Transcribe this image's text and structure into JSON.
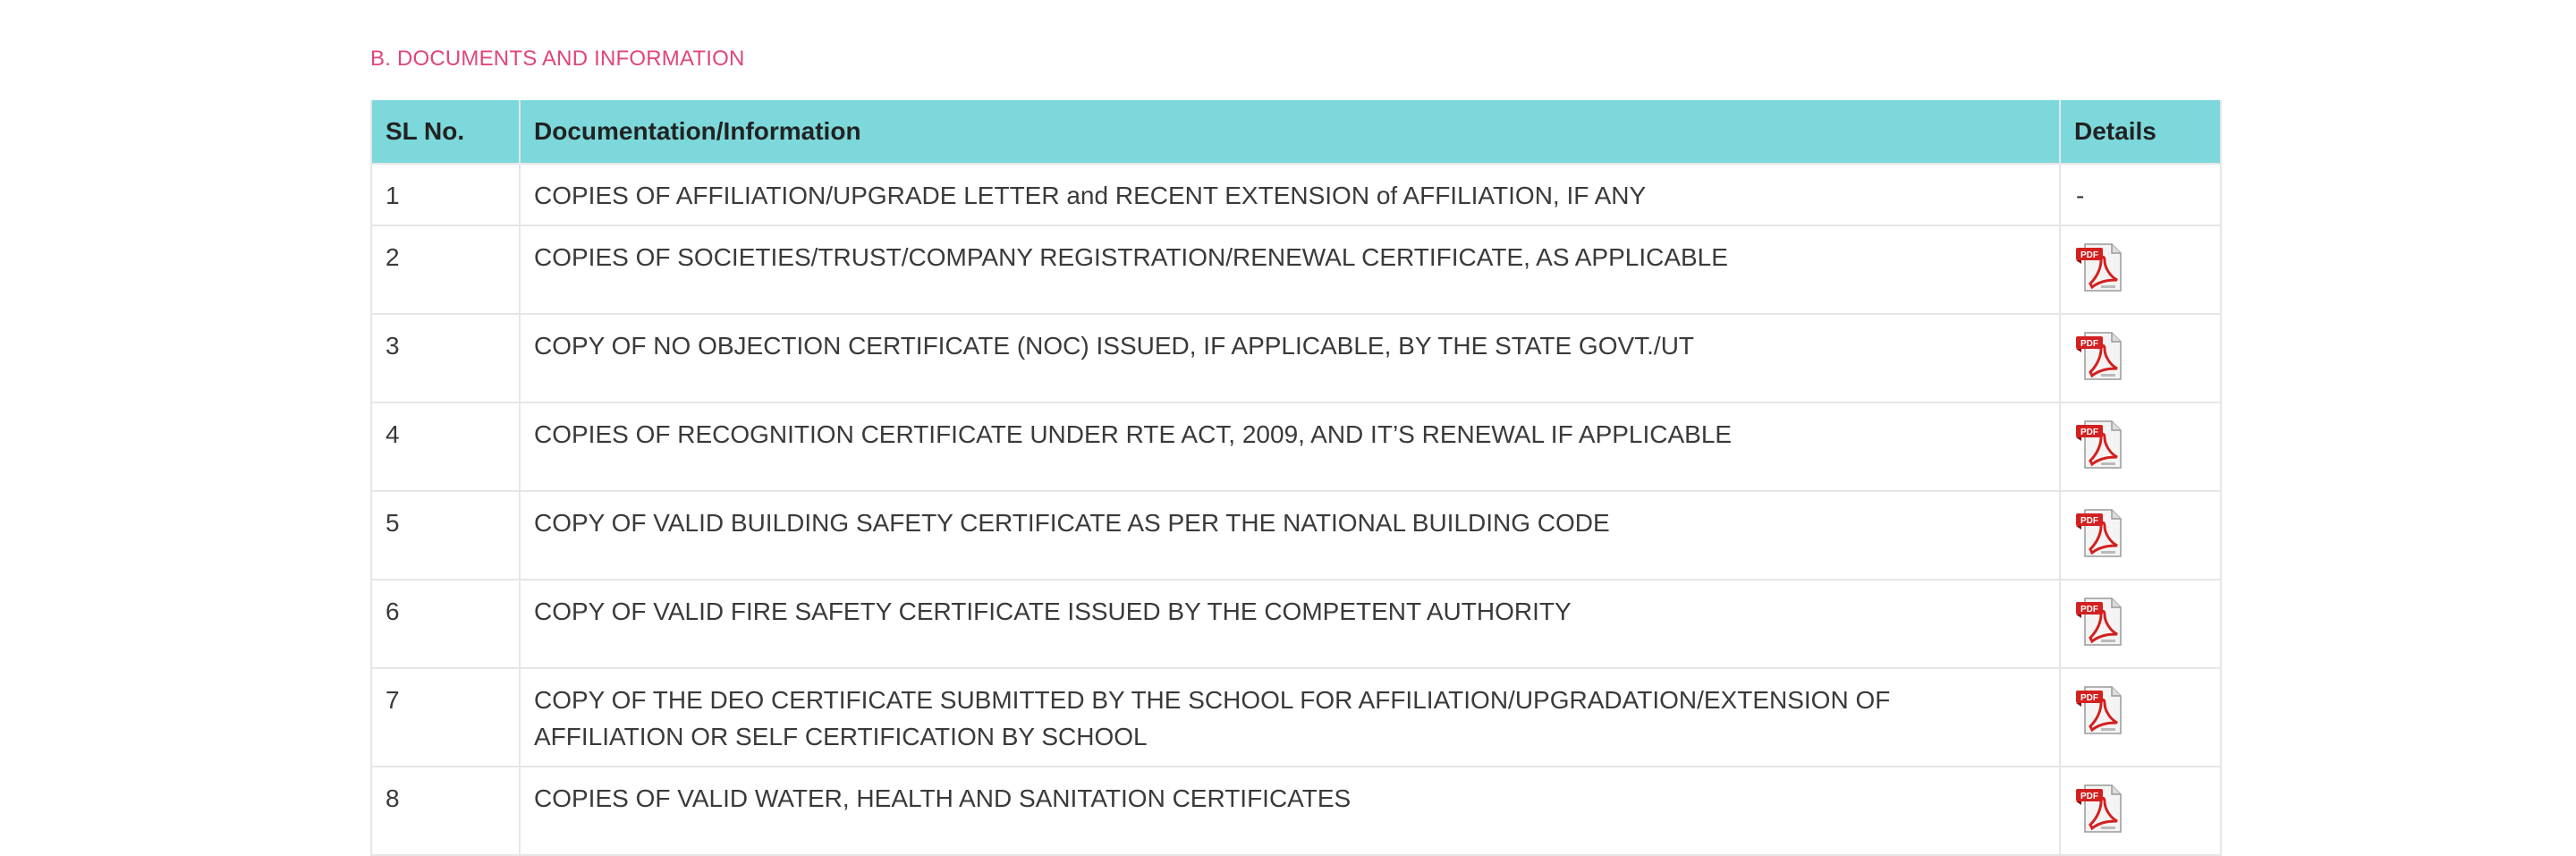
{
  "section": {
    "title": "B. DOCUMENTS AND INFORMATION"
  },
  "table": {
    "headers": {
      "sl": "SL No.",
      "doc": "Documentation/Information",
      "details": "Details"
    },
    "rows": [
      {
        "sl": "1",
        "doc": "COPIES OF AFFILIATION/UPGRADE LETTER and RECENT EXTENSION of AFFILIATION, IF ANY",
        "details": "-"
      },
      {
        "sl": "2",
        "doc": "COPIES OF SOCIETIES/TRUST/COMPANY REGISTRATION/RENEWAL CERTIFICATE, AS APPLICABLE",
        "details_icon": "pdf-icon"
      },
      {
        "sl": "3",
        "doc": "COPY OF NO OBJECTION CERTIFICATE (NOC) ISSUED, IF APPLICABLE, BY THE STATE GOVT./UT",
        "details_icon": "pdf-icon"
      },
      {
        "sl": "4",
        "doc": "COPIES OF RECOGNITION CERTIFICATE UNDER RTE ACT, 2009, AND IT’S RENEWAL IF APPLICABLE",
        "details_icon": "pdf-icon"
      },
      {
        "sl": "5",
        "doc": "COPY OF VALID BUILDING SAFETY CERTIFICATE AS PER THE NATIONAL BUILDING CODE",
        "details_icon": "pdf-icon"
      },
      {
        "sl": "6",
        "doc": "COPY OF VALID FIRE SAFETY CERTIFICATE ISSUED BY THE COMPETENT AUTHORITY",
        "details_icon": "pdf-icon"
      },
      {
        "sl": "7",
        "doc": "COPY OF THE DEO CERTIFICATE SUBMITTED BY THE SCHOOL FOR AFFILIATION/UPGRADATION/EXTENSION OF AFFILIATION OR SELF CERTIFICATION BY SCHOOL",
        "details_icon": "pdf-icon"
      },
      {
        "sl": "8",
        "doc": "COPIES OF VALID WATER, HEALTH AND SANITATION CERTIFICATES",
        "details_icon": "pdf-icon"
      }
    ]
  },
  "pdf_icon_label": "PDF",
  "colors": {
    "section_title": "#e0457b",
    "header_bg": "#7cd8db",
    "border": "#e6e6e6",
    "pdf_red": "#d32020"
  }
}
